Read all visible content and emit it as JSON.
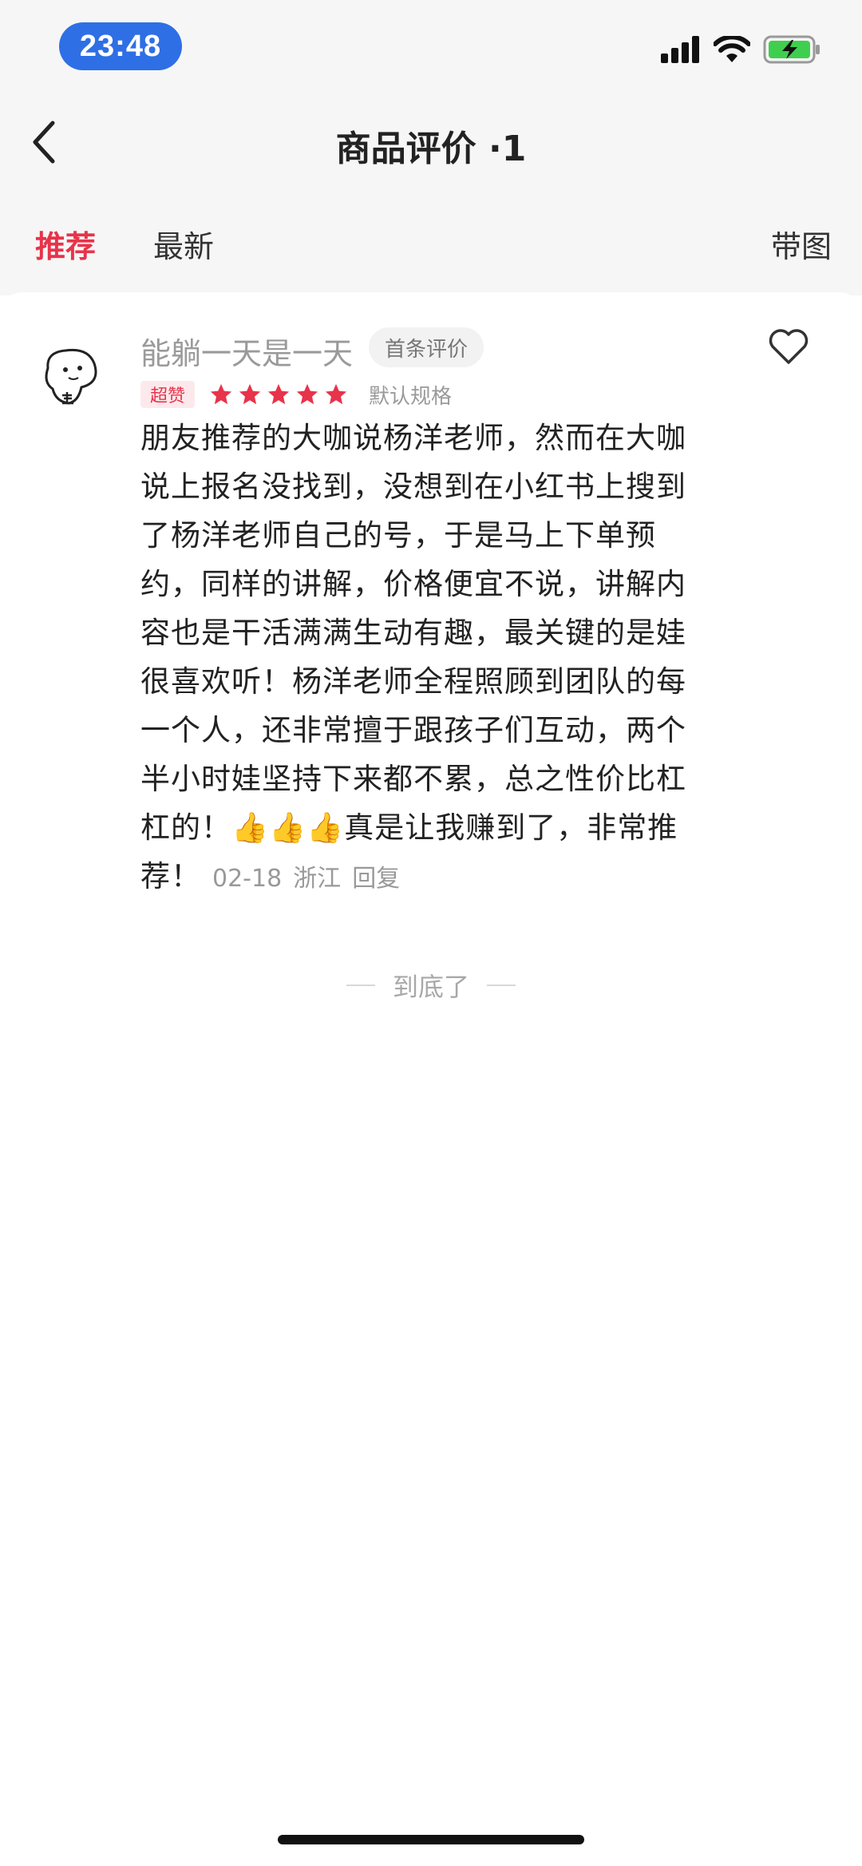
{
  "status_bar": {
    "time": "23:48"
  },
  "nav": {
    "title": "商品评价 ·1"
  },
  "tabs": [
    {
      "label": "推荐",
      "active": true
    },
    {
      "label": "最新",
      "active": false
    },
    {
      "label": "带图",
      "active": false
    }
  ],
  "review": {
    "username": "能躺一天是一天",
    "badge": "首条评价",
    "rating_label": "超赞",
    "stars": 5,
    "spec": "默认规格",
    "text": "朋友推荐的大咖说杨洋老师，然而在大咖说上报名没找到，没想到在小红书上搜到了杨洋老师自己的号，于是马上下单预约，同样的讲解，价格便宜不说，讲解内容也是干活满满生动有趣，最关键的是娃很喜欢听！杨洋老师全程照顾到团队的每一个人，还非常擅于跟孩子们互动，两个半小时娃坚持下来都不累，总之性价比杠杠的！",
    "emoji": "👍👍👍",
    "text_tail": "真是让我赚到了，非常推荐！",
    "date": "02-18",
    "location": "浙江",
    "reply_label": "回复"
  },
  "footer": {
    "end_text": "到底了"
  },
  "colors": {
    "accent": "#e8334a",
    "time_pill": "#2e6fe5",
    "battery": "#3fcf4f"
  },
  "icons": [
    "back-arrow-icon",
    "heart-icon",
    "star-icon",
    "signal-icon",
    "wifi-icon",
    "battery-icon"
  ]
}
